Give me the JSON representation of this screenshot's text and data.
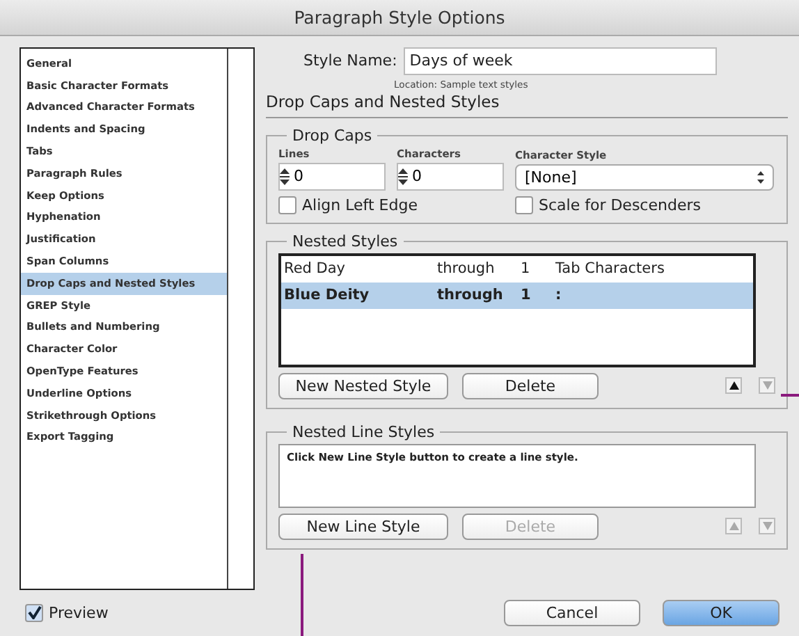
{
  "window": {
    "title": "Paragraph Style Options"
  },
  "sidebar": {
    "items": [
      {
        "label": "General",
        "selected": false
      },
      {
        "label": "Basic Character Formats",
        "selected": false
      },
      {
        "label": "Advanced Character Formats",
        "selected": false
      },
      {
        "label": "Indents and Spacing",
        "selected": false
      },
      {
        "label": "Tabs",
        "selected": false
      },
      {
        "label": "Paragraph Rules",
        "selected": false
      },
      {
        "label": "Keep Options",
        "selected": false
      },
      {
        "label": "Hyphenation",
        "selected": false
      },
      {
        "label": "Justification",
        "selected": false
      },
      {
        "label": "Span Columns",
        "selected": false
      },
      {
        "label": "Drop Caps and Nested Styles",
        "selected": true
      },
      {
        "label": "GREP Style",
        "selected": false
      },
      {
        "label": "Bullets and Numbering",
        "selected": false
      },
      {
        "label": "Character Color",
        "selected": false
      },
      {
        "label": "OpenType Features",
        "selected": false
      },
      {
        "label": "Underline Options",
        "selected": false
      },
      {
        "label": "Strikethrough Options",
        "selected": false
      },
      {
        "label": "Export Tagging",
        "selected": false
      }
    ]
  },
  "style_name": {
    "label": "Style Name:",
    "value": "Days of week"
  },
  "location": "Location: Sample text styles",
  "section_title": "Drop Caps and Nested Styles",
  "drop_caps": {
    "title": "Drop Caps",
    "lines": {
      "label": "Lines",
      "value": "0"
    },
    "characters": {
      "label": "Characters",
      "value": "0"
    },
    "character_style": {
      "label": "Character Style",
      "value": "[None]"
    },
    "checkboxes": [
      {
        "label": "Align Left Edge",
        "checked": false
      },
      {
        "label": "Scale for Descenders",
        "checked": false
      }
    ]
  },
  "nested_styles": {
    "title": "Nested Styles",
    "rows": [
      {
        "style": "Red Day",
        "mode": "through",
        "count": "1",
        "until": "Tab Characters",
        "selected": false
      },
      {
        "style": "Blue Deity",
        "mode": "through",
        "count": "1",
        "until": ":",
        "selected": true
      }
    ],
    "buttons": [
      {
        "label": "New Nested Style",
        "disabled": false
      },
      {
        "label": "Delete",
        "disabled": false
      }
    ],
    "move_up_disabled": false,
    "move_down_disabled": true
  },
  "nested_line_styles": {
    "title": "Nested Line Styles",
    "message": "Click New Line Style button to create a line style.",
    "buttons": [
      {
        "label": "New Line Style",
        "disabled": false
      },
      {
        "label": "Delete",
        "disabled": true
      }
    ],
    "move_up_disabled": true,
    "move_down_disabled": true
  },
  "preview": {
    "label": "Preview",
    "checked": true
  },
  "buttons": [
    {
      "label": "Cancel",
      "default": false
    },
    {
      "label": "OK",
      "default": true
    }
  ]
}
